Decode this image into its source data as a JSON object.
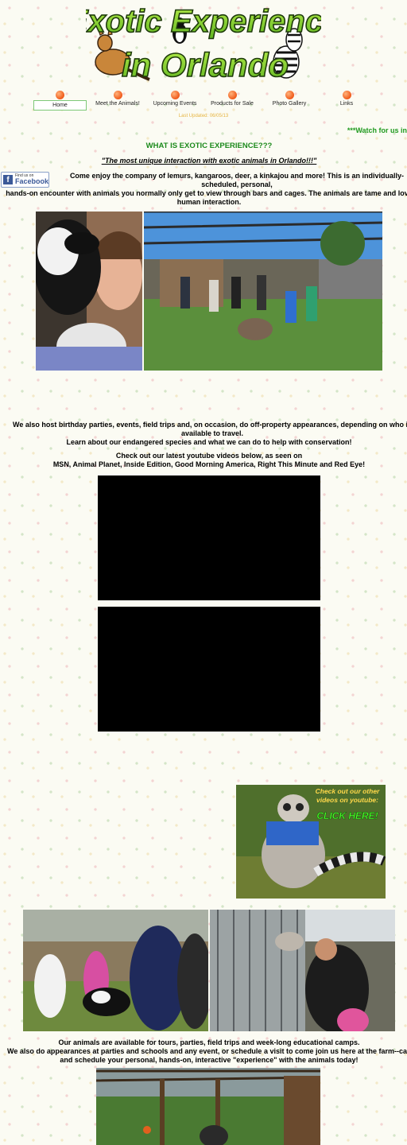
{
  "logo": {
    "line1": "Exotic Experience",
    "line2": "in Orlando"
  },
  "nav": [
    {
      "label": "Home",
      "active": true
    },
    {
      "label": "Meet the Animals!",
      "active": false
    },
    {
      "label": "Upcoming Events",
      "active": false
    },
    {
      "label": "Products for Sale",
      "active": false
    },
    {
      "label": "Photo Gallery",
      "active": false
    },
    {
      "label": "Links",
      "active": false
    }
  ],
  "last_updated": "Last Updated: 06/05/13",
  "watch_text": "***Watch for us in",
  "heading": "WHAT IS EXOTIC EXPERIENCE???",
  "tagline": "\"The most unique interaction with exotic animals in Orlando!!!\"",
  "facebook": {
    "small": "Find us on",
    "big": "Facebook"
  },
  "intro": {
    "line1": "Come enjoy the company of lemurs, kangaroos, deer, a kinkajou and more!  This is an individually-scheduled, personal,",
    "line2": "hands-on encounter with animals you normally only get to view through bars and cages.  The animals are tame and love human interaction."
  },
  "events": {
    "line1": "We also host birthday parties, events, field trips and, on occasion, do off-property appearances, depending on who is available to travel.",
    "line2": "Learn about our endangered species and what we can do to help with conservation!"
  },
  "youtube_intro": {
    "line1": "Check out our latest youtube videos below, as seen on",
    "line2": "MSN, Animal Planet, Inside Edition, Good Morning America, Right This Minute and Red Eye!"
  },
  "promo": {
    "line1": "Check out our other",
    "line2": "videos on youtube:",
    "cta": "CLICK HERE!"
  },
  "availability": {
    "line1": "Our animals are available for tours, parties, field trips and week-long educational camps.",
    "line2": "We also do appearances at parties and schools and any event, or schedule a visit to come join us here at the farm--call and schedule your personal, hands-on, interactive \"experience\" with the animals today!"
  },
  "colors": {
    "accent_green": "#1c8a1c",
    "nav_dot": "#f05a1a",
    "updated": "#e6b440",
    "facebook": "#3b5998"
  }
}
